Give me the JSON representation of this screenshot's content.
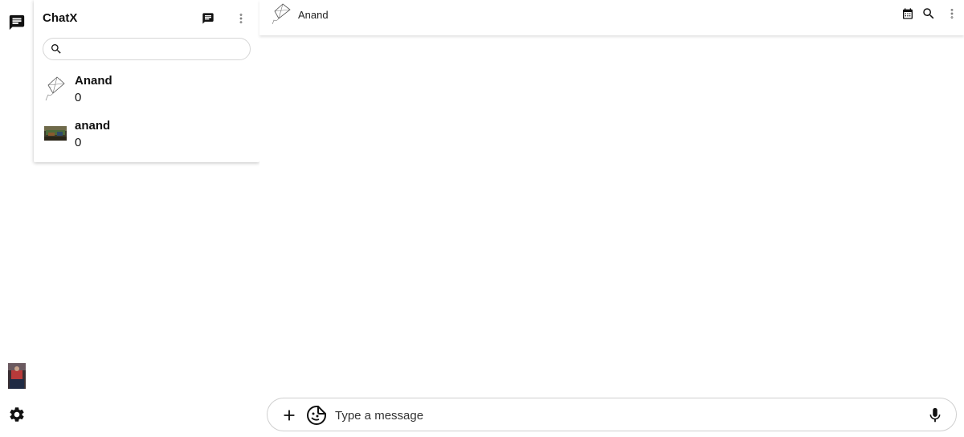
{
  "app": {
    "title": "ChatX"
  },
  "sidebar": {
    "search": {
      "value": "",
      "placeholder": ""
    },
    "chats": [
      {
        "name": "Anand",
        "count": "0",
        "avatar": "kite-sketch-avatar"
      },
      {
        "name": "anand",
        "count": "0",
        "avatar": "landscape-photo-avatar"
      }
    ]
  },
  "header": {
    "contact_name": "Anand"
  },
  "composer": {
    "placeholder": "Type a message",
    "value": ""
  },
  "icons": {
    "rail_top": "chat-icon",
    "rail_bottom": "settings-gear-icon",
    "new_chat": "message-icon",
    "menu": "more-vert-icon",
    "search": "search-icon",
    "calendar": "calendar-icon",
    "add": "plus-icon",
    "sticker": "sticker-icon",
    "mic": "microphone-icon"
  },
  "colors": {
    "icon": "#111111",
    "border": "#cfcfcf",
    "background": "#ffffff"
  }
}
